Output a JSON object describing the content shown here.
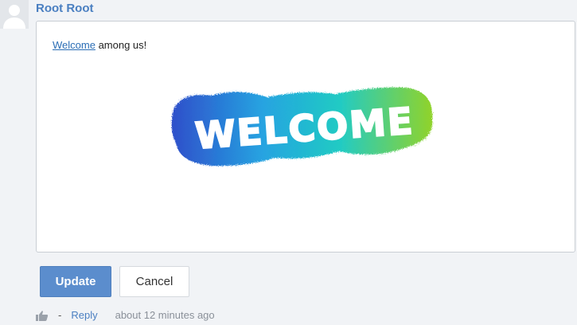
{
  "comment": {
    "author": "Root Root",
    "body_link_text": "Welcome",
    "body_text": " among us!",
    "image_text": "WELCOME"
  },
  "actions": {
    "update_label": "Update",
    "cancel_label": "Cancel"
  },
  "footer": {
    "separator": "-",
    "reply_label": "Reply",
    "timestamp": "about 12 minutes ago"
  },
  "colors": {
    "accent": "#5b8dcd",
    "link": "#4a7fc1",
    "background": "#f1f3f6"
  }
}
